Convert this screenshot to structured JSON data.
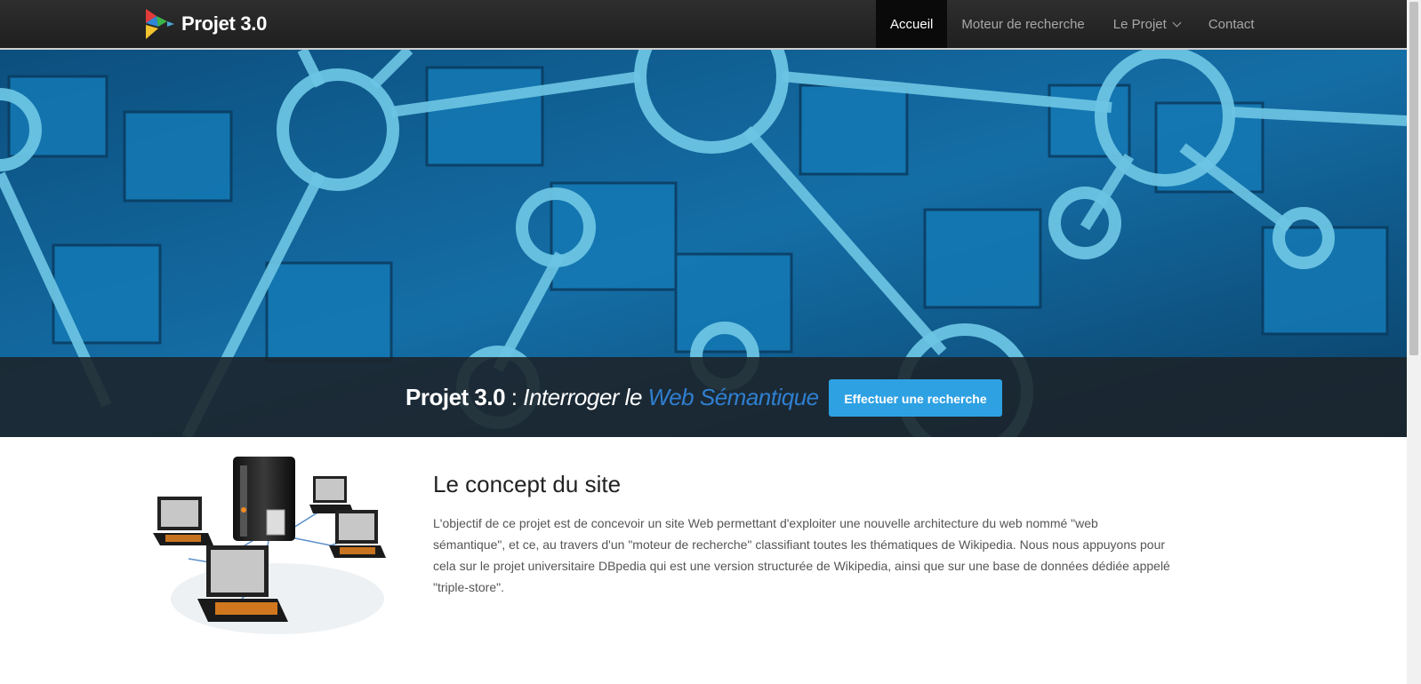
{
  "brand": {
    "name": "Projet 3.0"
  },
  "nav": {
    "items": [
      {
        "label": "Accueil",
        "active": true
      },
      {
        "label": "Moteur de recherche",
        "active": false
      },
      {
        "label": "Le Projet",
        "active": false,
        "dropdown": true
      },
      {
        "label": "Contact",
        "active": false
      }
    ]
  },
  "hero": {
    "title_strong": "Projet 3.0",
    "title_sep": " : ",
    "title_italic": "Interroger le ",
    "title_accent": "Web Sémantique",
    "cta_label": "Effectuer une recherche"
  },
  "concept": {
    "title": "Le concept du site",
    "text": "L'objectif de ce projet est de concevoir un site Web permettant d'exploiter une nouvelle architecture du web nommé \"web sémantique\", et ce, au travers d'un \"moteur de recherche\" classifiant toutes les thématiques de Wikipedia. Nous nous appuyons pour cela sur le projet universitaire DBpedia qui est une version structurée de Wikipedia, ainsi que sur une base de données dédiée appelé \"triple-store\"."
  },
  "colors": {
    "navbar": "#262626",
    "active_nav": "#0a0a0a",
    "hero_blue": "#0f5f93",
    "node_cyan": "#6cc4e3",
    "cta": "#2ea1e3",
    "accent_text": "#2f7fd0"
  },
  "icons": [
    "logo-icon",
    "chevron-down-icon",
    "network-illustration"
  ]
}
